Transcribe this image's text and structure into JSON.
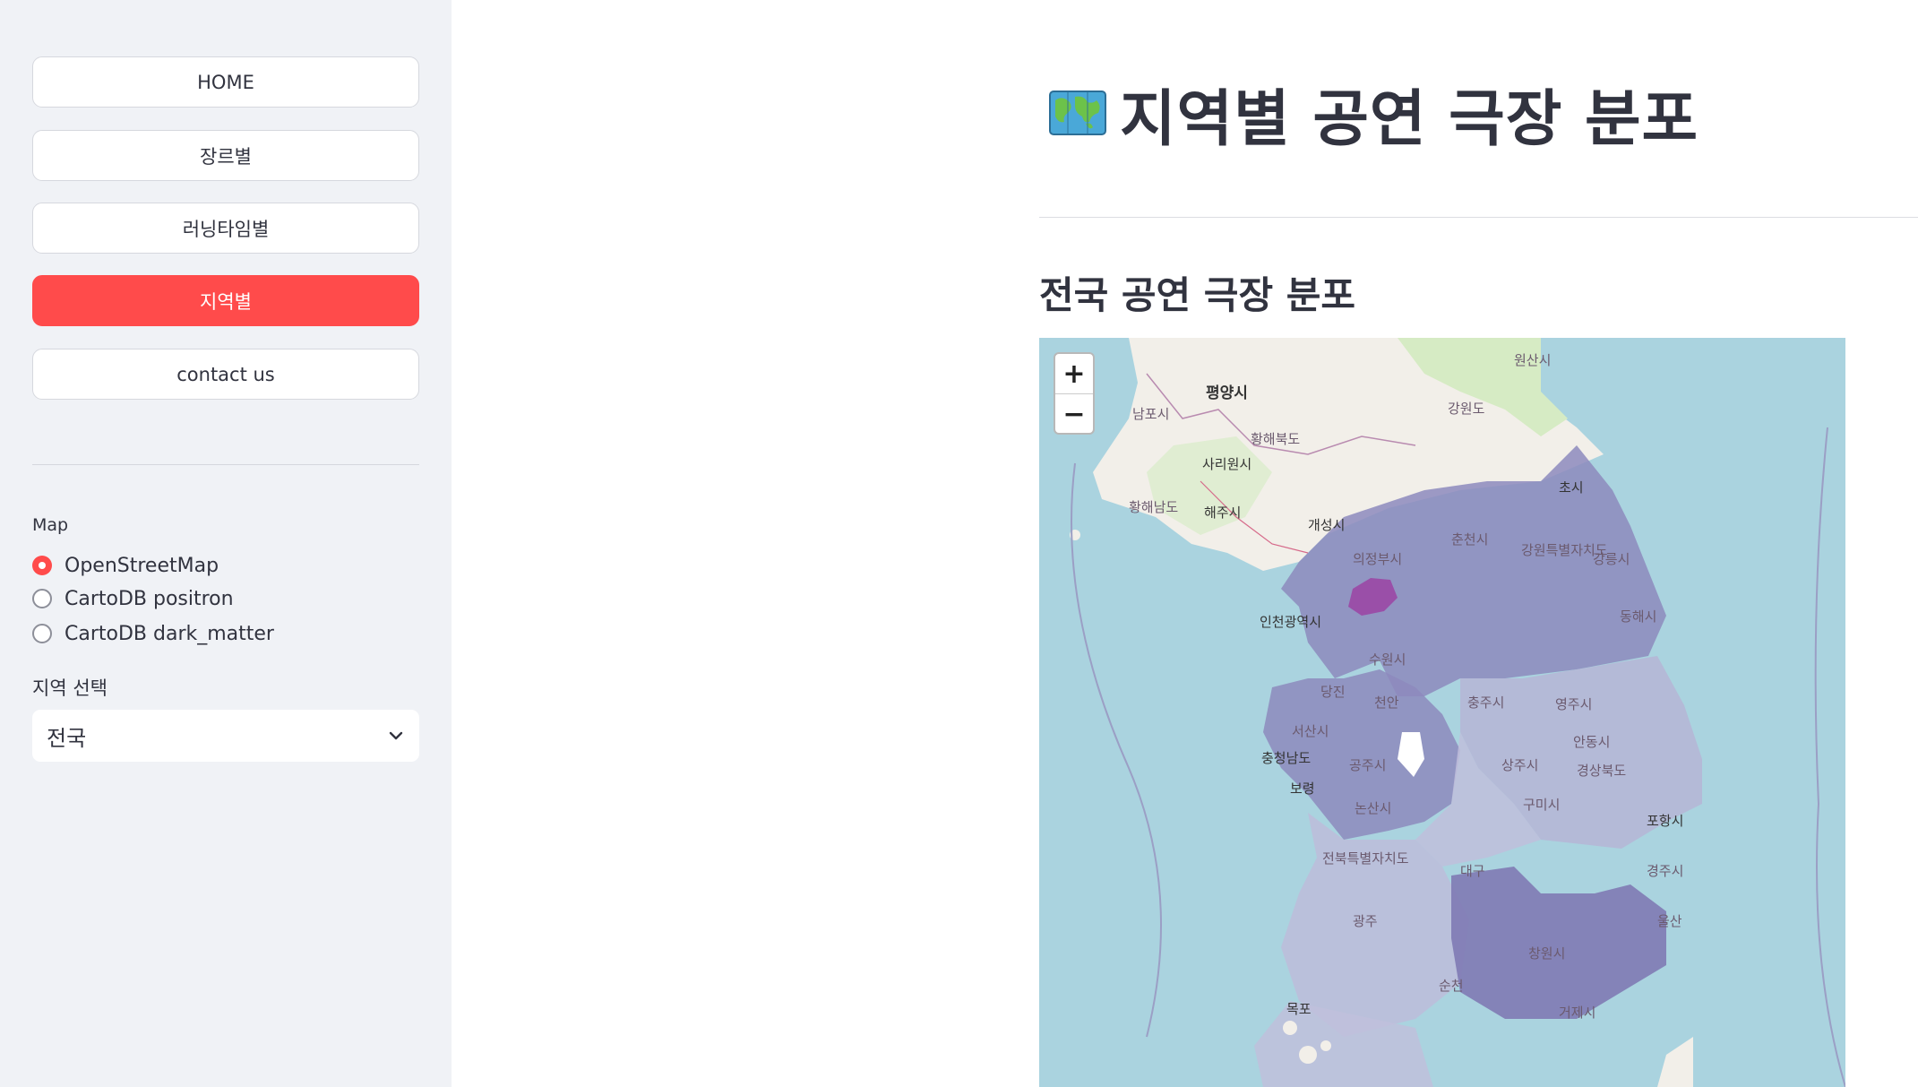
{
  "sidebar": {
    "nav": [
      {
        "label": "HOME",
        "active": false
      },
      {
        "label": "장르별",
        "active": false
      },
      {
        "label": "러닝타임별",
        "active": false
      },
      {
        "label": "지역별",
        "active": true
      },
      {
        "label": "contact us",
        "active": false
      }
    ],
    "map_label": "Map",
    "map_options": [
      {
        "label": "OpenStreetMap",
        "selected": true
      },
      {
        "label": "CartoDB positron",
        "selected": false
      },
      {
        "label": "CartoDB dark_matter",
        "selected": false
      }
    ],
    "region_label": "지역 선택",
    "region_value": "전국"
  },
  "main": {
    "title_icon": "world-map-icon",
    "title": "지역별 공연 극장 분포",
    "subtitle": "전국 공연 극장 분포"
  },
  "map": {
    "zoom_in": "+",
    "zoom_out": "−",
    "labels": [
      "원산시",
      "평양시",
      "강원도",
      "남포시",
      "황해북도",
      "사리원시",
      "황해남도",
      "해주시",
      "개성시",
      "초시",
      "춘천시",
      "의정부시",
      "강원특별자치도",
      "강릉시",
      "인천광역시",
      "수원시",
      "동해시",
      "당진",
      "천안",
      "서산시",
      "충청남도",
      "보령",
      "공주시",
      "논산시",
      "충주시",
      "영주시",
      "안동시",
      "상주시",
      "구미시",
      "경상북도",
      "포항시",
      "대구",
      "경주시",
      "전북특별자치도",
      "광주",
      "순천",
      "목포",
      "창원시",
      "거제시",
      "울산"
    ]
  },
  "colors": {
    "accent": "#ff4b4b",
    "sidebar_bg": "#f0f2f6",
    "sea": "#aad3df",
    "land": "#f2efe9",
    "region_purple": "#8d89bd",
    "seoul": "#9a4fa8"
  }
}
